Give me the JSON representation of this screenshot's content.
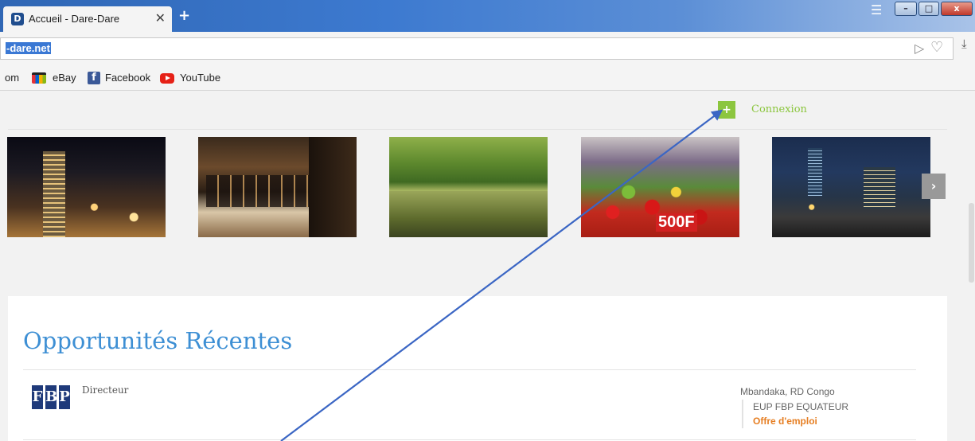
{
  "browser": {
    "tab_title": "Accueil - Dare-Dare",
    "tab_close": "✕",
    "new_tab": "+",
    "url": "-dare.net",
    "window_controls": {
      "menu": "☰",
      "minimize": "–",
      "maximize": "□",
      "close": "x"
    }
  },
  "bookmarks": [
    {
      "label": "om"
    },
    {
      "label": "eBay",
      "icon": "ebay-icon"
    },
    {
      "label": "Facebook",
      "icon": "facebook-icon"
    },
    {
      "label": "YouTube",
      "icon": "youtube-icon"
    }
  ],
  "header": {
    "plus": "+",
    "login_label": "Connexion",
    "accent": "#8cc63f"
  },
  "slider": {
    "next": "›",
    "thumb4_label": "500F"
  },
  "section": {
    "title": "Opportunités Récentes",
    "title_color": "#3d8fd4"
  },
  "jobs": [
    {
      "logo_letters": [
        "F",
        "B",
        "P"
      ],
      "title": "Directeur",
      "location": "Mbandaka, RD Congo",
      "company": "EUP FBP EQUATEUR",
      "type": "Offre d'emploi",
      "type_color": "#e67e22"
    }
  ]
}
